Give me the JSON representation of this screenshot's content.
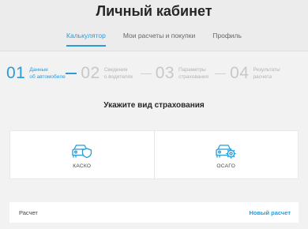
{
  "header": {
    "title": "Личный кабинет",
    "tabs": [
      {
        "label": "Калькулятор",
        "active": true
      },
      {
        "label": "Мои расчеты и покупки",
        "active": false
      },
      {
        "label": "Профиль",
        "active": false
      }
    ]
  },
  "steps": [
    {
      "num": "01",
      "line1": "Данные",
      "line2": "об автомобиле",
      "active": true
    },
    {
      "num": "02",
      "line1": "Сведения",
      "line2": "о водителях",
      "active": false
    },
    {
      "num": "03",
      "line1": "Параметры",
      "line2": "страхования",
      "active": false
    },
    {
      "num": "04",
      "line1": "Результаты",
      "line2": "расчета",
      "active": false
    }
  ],
  "main": {
    "section_title": "Укажите вид страхования",
    "options": [
      {
        "label": "КАСКО",
        "icon": "car-shield-icon"
      },
      {
        "label": "ОСАГО",
        "icon": "car-gear-icon"
      }
    ]
  },
  "calc_bar": {
    "label": "Расчет",
    "new_calc_label": "Новый расчет"
  },
  "colors": {
    "accent": "#2b9bd6",
    "background": "#f2f2f2",
    "header_bg": "#ececec"
  }
}
